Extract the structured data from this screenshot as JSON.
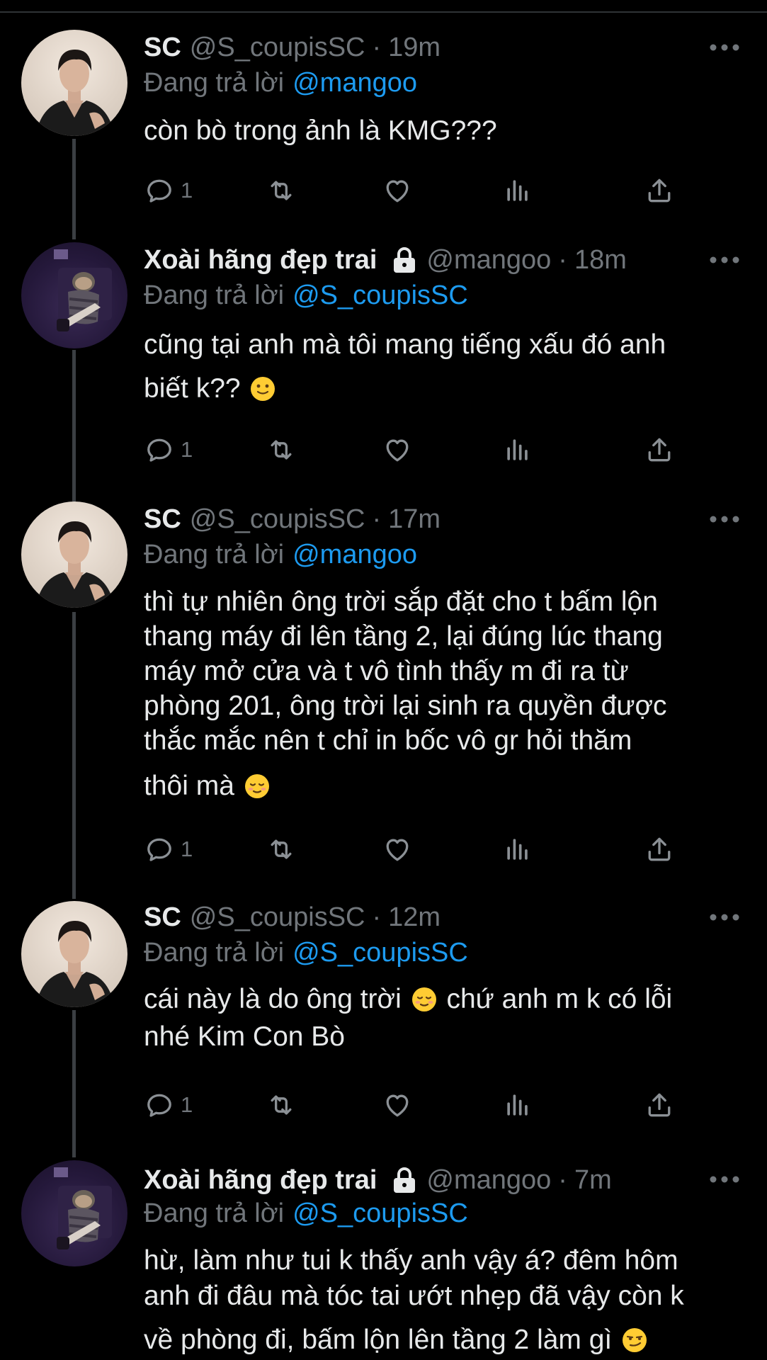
{
  "tweets": [
    {
      "display_name": "SC",
      "handle": "@S_coupisSC",
      "time": "19m",
      "replying_prefix": "Đang trả lời",
      "replying_to": "@mangoo",
      "text_lines": [
        "còn bò trong ảnh là KMG???"
      ],
      "reply_count": "1",
      "verified_lock": false
    },
    {
      "display_name": "Xoài hãng đẹp trai",
      "handle": "@mangoo",
      "time": "18m",
      "replying_prefix": "Đang trả lời",
      "replying_to": "@S_coupisSC",
      "text_lines": [
        "cũng tại anh mà tôi mang tiếng xấu đó anh",
        "biết k??"
      ],
      "reply_count": "1",
      "verified_lock": true
    },
    {
      "display_name": "SC",
      "handle": "@S_coupisSC",
      "time": "17m",
      "replying_prefix": "Đang trả lời",
      "replying_to": "@mangoo",
      "text_lines": [
        "thì tự nhiên ông trời sắp đặt cho t bấm lộn",
        "thang máy đi lên tầng 2, lại đúng lúc thang",
        "máy mở cửa và t vô tình thấy m đi ra từ",
        "phòng 201, ông trời lại sinh ra quyền được",
        "thắc mắc nên t chỉ in bốc vô gr hỏi thăm",
        "thôi mà"
      ],
      "reply_count": "1",
      "verified_lock": false
    },
    {
      "display_name": "SC",
      "handle": "@S_coupisSC",
      "time": "12m",
      "replying_prefix": "Đang trả lời",
      "replying_to": "@S_coupisSC",
      "text_lines": [
        "cái này là do ông trời",
        "chứ anh m k có lỗi",
        "nhé Kim Con Bò"
      ],
      "reply_count": "1",
      "verified_lock": false
    },
    {
      "display_name": "Xoài hãng đẹp trai",
      "handle": "@mangoo",
      "time": "7m",
      "replying_prefix": "Đang trả lời",
      "replying_to": "@S_coupisSC",
      "text_lines": [
        "hừ, làm như tui k thấy anh vậy á? đêm hôm",
        "anh đi đâu mà tóc tai ướt nhẹp đã vậy còn k",
        "về phòng đi, bấm lộn lên tầng 2 làm gì"
      ],
      "reply_count": "",
      "verified_lock": true
    }
  ],
  "icons": {
    "reply": "reply-icon",
    "retweet": "retweet-icon",
    "like": "heart-icon",
    "views": "views-icon",
    "share": "share-icon",
    "more": "more-icon",
    "lock": "lock-icon",
    "emoji_smile": "slightly-smiling-face-emoji",
    "emoji_relieved": "relieved-face-emoji",
    "emoji_smirk": "smirking-face-emoji"
  },
  "colors": {
    "background": "#000000",
    "text": "#e7e9ea",
    "secondary": "#71767b",
    "mention": "#1d9bf0",
    "thread_line": "#3b3f43"
  }
}
